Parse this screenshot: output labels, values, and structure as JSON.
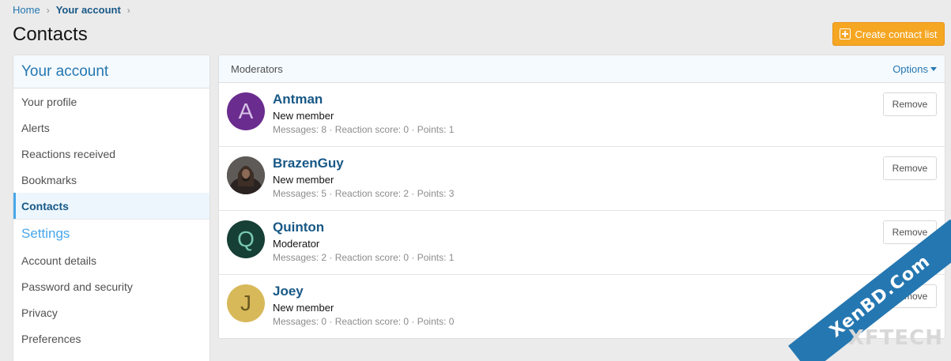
{
  "breadcrumb": {
    "home": "Home",
    "current": "Your account"
  },
  "page_title": "Contacts",
  "actions": {
    "create_label": "Create contact list"
  },
  "sidebar": {
    "header": "Your account",
    "items": [
      {
        "label": "Your profile"
      },
      {
        "label": "Alerts"
      },
      {
        "label": "Reactions received"
      },
      {
        "label": "Bookmarks"
      },
      {
        "label": "Contacts",
        "active": true
      }
    ],
    "settings_header": "Settings",
    "settings_items": [
      {
        "label": "Account details"
      },
      {
        "label": "Password and security"
      },
      {
        "label": "Privacy"
      },
      {
        "label": "Preferences"
      }
    ]
  },
  "main": {
    "tab_label": "Moderators",
    "options_label": "Options",
    "members": [
      {
        "name": "Antman",
        "initial": "A",
        "avatar_bg": "#6a2c8e",
        "avatar_fg": "#d7c2e6",
        "title": "New member",
        "stats": "Messages: 8 · Reaction score: 0 · Points: 1",
        "remove": "Remove"
      },
      {
        "name": "BrazenGuy",
        "initial": "",
        "avatar_bg": "#3b3431",
        "avatar_fg": "#ffffff",
        "title": "New member",
        "stats": "Messages: 5 · Reaction score: 2 · Points: 3",
        "remove": "Remove"
      },
      {
        "name": "Quinton",
        "initial": "Q",
        "avatar_bg": "#163f35",
        "avatar_fg": "#79c8b3",
        "title": "Moderator",
        "stats": "Messages: 2 · Reaction score: 0 · Points: 1",
        "remove": "Remove"
      },
      {
        "name": "Joey",
        "initial": "J",
        "avatar_bg": "#d8b95a",
        "avatar_fg": "#6b5a20",
        "title": "New member",
        "stats": "Messages: 0 · Reaction score: 0 · Points: 0",
        "remove": "Remove"
      }
    ]
  },
  "watermark": {
    "text": "XenBD.Com",
    "sub": "XFTECH"
  },
  "colors": {
    "accent": "#2577b1",
    "button": "#f5a623"
  }
}
